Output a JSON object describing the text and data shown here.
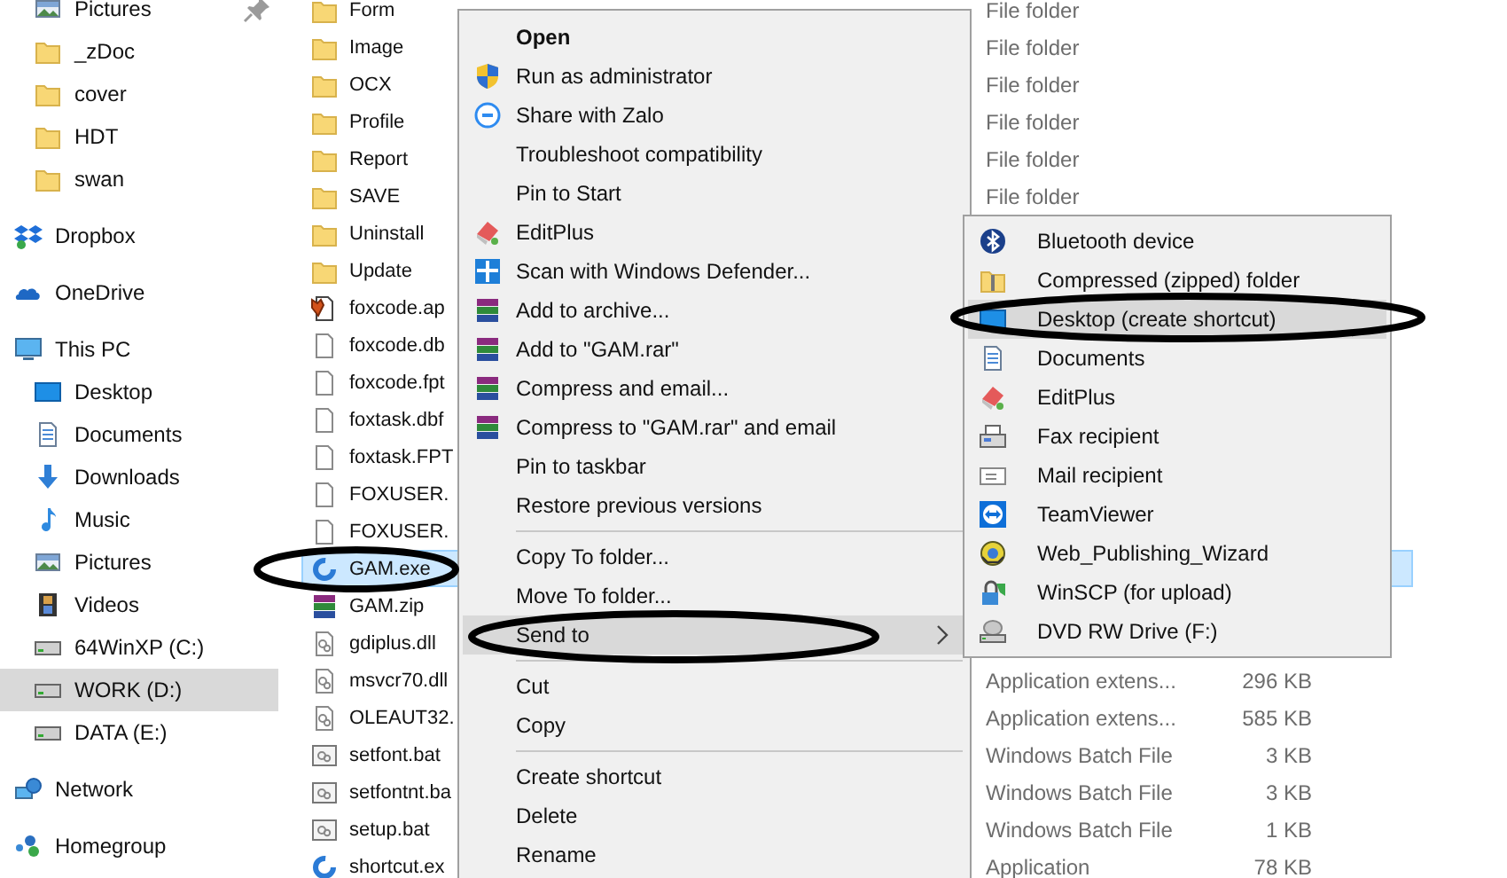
{
  "sidebar": {
    "quick_access": [
      {
        "label": "Pictures",
        "kind": "pictures",
        "pinned": true,
        "selected": false
      },
      {
        "label": "_zDoc",
        "kind": "folder",
        "pinned": false,
        "selected": false
      },
      {
        "label": "cover",
        "kind": "folder",
        "pinned": false,
        "selected": false
      },
      {
        "label": "HDT",
        "kind": "folder",
        "pinned": false,
        "selected": false
      },
      {
        "label": "swan",
        "kind": "folder",
        "pinned": false,
        "selected": false
      }
    ],
    "items": [
      {
        "label": "Dropbox",
        "kind": "dropbox",
        "selected": false
      },
      {
        "label": "OneDrive",
        "kind": "onedrive",
        "selected": false
      },
      {
        "label": "This PC",
        "kind": "pc",
        "selected": false,
        "children": [
          {
            "label": "Desktop",
            "kind": "desktop",
            "selected": false
          },
          {
            "label": "Documents",
            "kind": "documents",
            "selected": false
          },
          {
            "label": "Downloads",
            "kind": "downloads",
            "selected": false
          },
          {
            "label": "Music",
            "kind": "music",
            "selected": false
          },
          {
            "label": "Pictures",
            "kind": "pictures",
            "selected": false
          },
          {
            "label": "Videos",
            "kind": "videos",
            "selected": false
          },
          {
            "label": "64WinXP  (C:)",
            "kind": "drive",
            "selected": false
          },
          {
            "label": "WORK (D:)",
            "kind": "drive",
            "selected": true
          },
          {
            "label": "DATA (E:)",
            "kind": "drive",
            "selected": false
          }
        ]
      },
      {
        "label": "Network",
        "kind": "network",
        "selected": false
      },
      {
        "label": "Homegroup",
        "kind": "homegroup",
        "selected": false
      }
    ]
  },
  "files": [
    {
      "name": "Form",
      "kind": "folder",
      "type": "File folder",
      "selected": false
    },
    {
      "name": "Image",
      "kind": "folder",
      "type": "File folder",
      "selected": false
    },
    {
      "name": "OCX",
      "kind": "folder",
      "type": "File folder",
      "selected": false
    },
    {
      "name": "Profile",
      "kind": "folder",
      "type": "File folder",
      "selected": false
    },
    {
      "name": "Report",
      "kind": "folder",
      "type": "File folder",
      "selected": false
    },
    {
      "name": "SAVE",
      "kind": "folder",
      "type": "File folder",
      "selected": false
    },
    {
      "name": "Uninstall",
      "kind": "folder",
      "selected": false
    },
    {
      "name": "Update",
      "kind": "folder",
      "selected": false
    },
    {
      "name": "foxcode.ap",
      "kind": "foxpro",
      "selected": false
    },
    {
      "name": "foxcode.db",
      "kind": "file",
      "selected": false
    },
    {
      "name": "foxcode.fpt",
      "kind": "file",
      "selected": false
    },
    {
      "name": "foxtask.dbf",
      "kind": "file",
      "selected": false
    },
    {
      "name": "foxtask.FPT",
      "kind": "file",
      "selected": false
    },
    {
      "name": "FOXUSER.",
      "kind": "file",
      "selected": false
    },
    {
      "name": "FOXUSER.",
      "kind": "file",
      "selected": false
    },
    {
      "name": "GAM.exe",
      "kind": "exe",
      "selected": true
    },
    {
      "name": "GAM.zip",
      "kind": "zip",
      "selected": false
    },
    {
      "name": "gdiplus.dll",
      "kind": "dll",
      "selected": false
    },
    {
      "name": "msvcr70.dll",
      "kind": "dll",
      "type": "Application extens...",
      "size": "296 KB",
      "selected": false
    },
    {
      "name": "OLEAUT32.",
      "kind": "dll",
      "type": "Application extens...",
      "size": "585 KB",
      "selected": false
    },
    {
      "name": "setfont.bat",
      "kind": "bat",
      "type": "Windows Batch File",
      "size": "3 KB",
      "selected": false
    },
    {
      "name": "setfontnt.ba",
      "kind": "bat",
      "type": "Windows Batch File",
      "size": "3 KB",
      "selected": false
    },
    {
      "name": "setup.bat",
      "kind": "bat",
      "type": "Windows Batch File",
      "size": "1 KB",
      "selected": false
    },
    {
      "name": "shortcut.ex",
      "kind": "exe",
      "type": "Application",
      "size": "78 KB",
      "selected": false
    }
  ],
  "context_menu": {
    "groups": [
      [
        {
          "label": "Open",
          "kind": "none",
          "default": true,
          "selected": false
        },
        {
          "label": "Run as administrator",
          "kind": "shield",
          "selected": false
        },
        {
          "label": "Share with Zalo",
          "kind": "zalo",
          "selected": false
        },
        {
          "label": "Troubleshoot compatibility",
          "kind": "none",
          "selected": false
        },
        {
          "label": "Pin to Start",
          "kind": "none",
          "selected": false
        },
        {
          "label": "EditPlus",
          "kind": "editplus",
          "selected": false
        },
        {
          "label": "Scan with Windows Defender...",
          "kind": "defender",
          "selected": false
        },
        {
          "label": "Add to archive...",
          "kind": "rar",
          "selected": false
        },
        {
          "label": "Add to \"GAM.rar\"",
          "kind": "rar",
          "selected": false
        },
        {
          "label": "Compress and email...",
          "kind": "rar",
          "selected": false
        },
        {
          "label": "Compress to \"GAM.rar\" and email",
          "kind": "rar",
          "selected": false
        },
        {
          "label": "Pin to taskbar",
          "kind": "none",
          "selected": false
        },
        {
          "label": "Restore previous versions",
          "kind": "none",
          "selected": false
        }
      ],
      [
        {
          "label": "Copy To folder...",
          "kind": "none",
          "selected": false
        },
        {
          "label": "Move To folder...",
          "kind": "none",
          "selected": false
        },
        {
          "label": "Send to",
          "kind": "none",
          "submenu": true,
          "selected": true
        }
      ],
      [
        {
          "label": "Cut",
          "kind": "none",
          "selected": false
        },
        {
          "label": "Copy",
          "kind": "none",
          "selected": false
        }
      ],
      [
        {
          "label": "Create shortcut",
          "kind": "none",
          "selected": false
        },
        {
          "label": "Delete",
          "kind": "none",
          "selected": false
        },
        {
          "label": "Rename",
          "kind": "none",
          "selected": false
        }
      ]
    ]
  },
  "send_to_menu": {
    "items": [
      {
        "label": "Bluetooth device",
        "kind": "bluetooth",
        "selected": false
      },
      {
        "label": "Compressed (zipped) folder",
        "kind": "zipfolder",
        "selected": false
      },
      {
        "label": "Desktop (create shortcut)",
        "kind": "desktop",
        "selected": true
      },
      {
        "label": "Documents",
        "kind": "documents",
        "selected": false
      },
      {
        "label": "EditPlus",
        "kind": "editplus",
        "selected": false
      },
      {
        "label": "Fax recipient",
        "kind": "fax",
        "selected": false
      },
      {
        "label": "Mail recipient",
        "kind": "mail",
        "selected": false
      },
      {
        "label": "TeamViewer",
        "kind": "teamviewer",
        "selected": false
      },
      {
        "label": "Web_Publishing_Wizard",
        "kind": "webwizard",
        "selected": false
      },
      {
        "label": "WinSCP (for upload)",
        "kind": "winscp",
        "selected": false
      },
      {
        "label": "DVD RW Drive (F:)",
        "kind": "dvd",
        "selected": false
      }
    ]
  }
}
